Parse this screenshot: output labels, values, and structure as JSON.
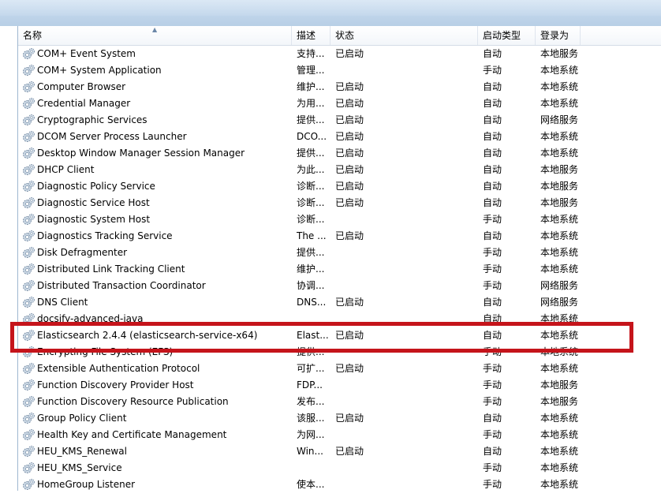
{
  "columns": {
    "name": "名称",
    "description": "描述",
    "status": "状态",
    "startup": "启动类型",
    "logon": "登录为"
  },
  "services": [
    {
      "name": "COM+ Event System",
      "desc": "支持...",
      "status": "已启动",
      "startup": "自动",
      "logon": "本地服务"
    },
    {
      "name": "COM+ System Application",
      "desc": "管理...",
      "status": "",
      "startup": "手动",
      "logon": "本地系统"
    },
    {
      "name": "Computer Browser",
      "desc": "维护...",
      "status": "已启动",
      "startup": "自动",
      "logon": "本地系统"
    },
    {
      "name": "Credential Manager",
      "desc": "为用...",
      "status": "已启动",
      "startup": "自动",
      "logon": "本地系统"
    },
    {
      "name": "Cryptographic Services",
      "desc": "提供...",
      "status": "已启动",
      "startup": "自动",
      "logon": "网络服务"
    },
    {
      "name": "DCOM Server Process Launcher",
      "desc": "DCO...",
      "status": "已启动",
      "startup": "自动",
      "logon": "本地系统"
    },
    {
      "name": "Desktop Window Manager Session Manager",
      "desc": "提供...",
      "status": "已启动",
      "startup": "自动",
      "logon": "本地系统"
    },
    {
      "name": "DHCP Client",
      "desc": "为此...",
      "status": "已启动",
      "startup": "自动",
      "logon": "本地服务"
    },
    {
      "name": "Diagnostic Policy Service",
      "desc": "诊断...",
      "status": "已启动",
      "startup": "自动",
      "logon": "本地服务"
    },
    {
      "name": "Diagnostic Service Host",
      "desc": "诊断...",
      "status": "已启动",
      "startup": "自动",
      "logon": "本地服务"
    },
    {
      "name": "Diagnostic System Host",
      "desc": "诊断...",
      "status": "",
      "startup": "手动",
      "logon": "本地系统"
    },
    {
      "name": "Diagnostics Tracking Service",
      "desc": "The ...",
      "status": "已启动",
      "startup": "自动",
      "logon": "本地系统"
    },
    {
      "name": "Disk Defragmenter",
      "desc": "提供...",
      "status": "",
      "startup": "手动",
      "logon": "本地系统"
    },
    {
      "name": "Distributed Link Tracking Client",
      "desc": "维护...",
      "status": "",
      "startup": "手动",
      "logon": "本地系统"
    },
    {
      "name": "Distributed Transaction Coordinator",
      "desc": "协调...",
      "status": "",
      "startup": "手动",
      "logon": "网络服务"
    },
    {
      "name": "DNS Client",
      "desc": "DNS...",
      "status": "已启动",
      "startup": "自动",
      "logon": "网络服务"
    },
    {
      "name": "docsify-advanced-java",
      "desc": "",
      "status": "",
      "startup": "自动",
      "logon": "本地系统"
    },
    {
      "name": "Elasticsearch 2.4.4 (elasticsearch-service-x64)",
      "desc": "Elast...",
      "status": "已启动",
      "startup": "自动",
      "logon": "本地系统"
    },
    {
      "name": "Encrypting File System (EFS)",
      "desc": "提供...",
      "status": "",
      "startup": "手动",
      "logon": "本地系统"
    },
    {
      "name": "Extensible Authentication Protocol",
      "desc": "可扩...",
      "status": "已启动",
      "startup": "手动",
      "logon": "本地系统"
    },
    {
      "name": "Function Discovery Provider Host",
      "desc": "FDP...",
      "status": "",
      "startup": "手动",
      "logon": "本地服务"
    },
    {
      "name": "Function Discovery Resource Publication",
      "desc": "发布...",
      "status": "",
      "startup": "手动",
      "logon": "本地服务"
    },
    {
      "name": "Group Policy Client",
      "desc": "该服...",
      "status": "已启动",
      "startup": "自动",
      "logon": "本地系统"
    },
    {
      "name": "Health Key and Certificate Management",
      "desc": "为网...",
      "status": "",
      "startup": "手动",
      "logon": "本地系统"
    },
    {
      "name": "HEU_KMS_Renewal",
      "desc": "Win...",
      "status": "已启动",
      "startup": "自动",
      "logon": "本地系统"
    },
    {
      "name": "HEU_KMS_Service",
      "desc": "",
      "status": "",
      "startup": "手动",
      "logon": "本地系统"
    },
    {
      "name": "HomeGroup Listener",
      "desc": "使本...",
      "status": "",
      "startup": "手动",
      "logon": "本地系统"
    }
  ],
  "highlight_color": "#c5141b",
  "service_icon": "gear-icon"
}
